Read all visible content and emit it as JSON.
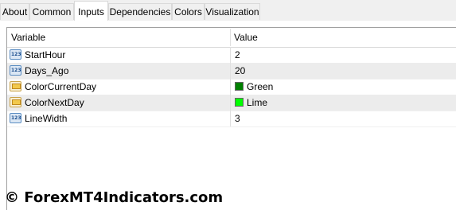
{
  "tabs": [
    "About",
    "Common",
    "Inputs",
    "Dependencies",
    "Colors",
    "Visualization"
  ],
  "active_tab": "Inputs",
  "table": {
    "headers": {
      "variable": "Variable",
      "value": "Value"
    },
    "rows": [
      {
        "icon": "numeric-param-icon",
        "variable": "StartHour",
        "value": "2"
      },
      {
        "icon": "numeric-param-icon",
        "variable": "Days_Ago",
        "value": "20"
      },
      {
        "icon": "color-param-icon",
        "variable": "ColorCurrentDay",
        "value": "Green",
        "swatch": "#008000"
      },
      {
        "icon": "color-param-icon",
        "variable": "ColorNextDay",
        "value": "Lime",
        "swatch": "#00ff00"
      },
      {
        "icon": "numeric-param-icon",
        "variable": "LineWidth",
        "value": "3"
      }
    ]
  },
  "watermark": "© ForexMT4Indicators.com"
}
